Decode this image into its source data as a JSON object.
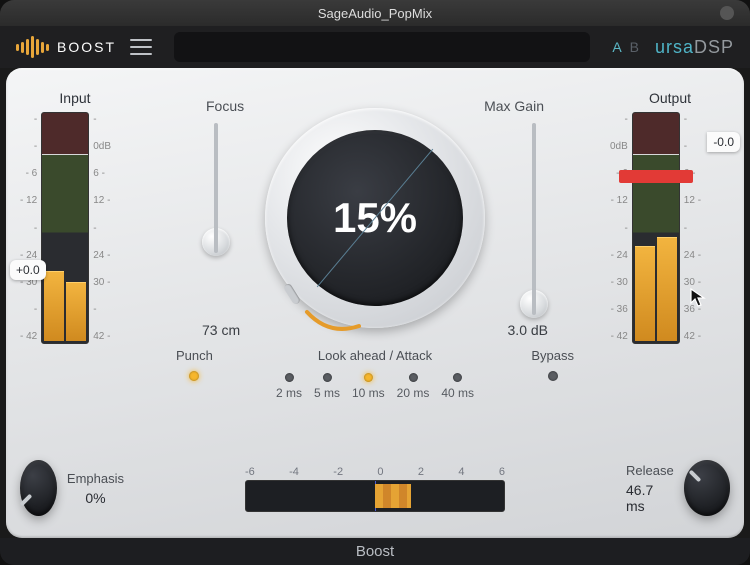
{
  "window": {
    "title": "SageAudio_PopMix"
  },
  "header": {
    "product_name": "BOOST",
    "ab": {
      "a": "A",
      "b": "B"
    },
    "brand_ursa": "ursa",
    "brand_dsp": "DSP"
  },
  "input": {
    "label": "Input",
    "ticks_left": [
      "-",
      "-",
      "- 6",
      "- 12",
      "-",
      "- 24",
      "- 30",
      "-",
      "- 42"
    ],
    "ticks_right": [
      "-",
      "0dB",
      "6 -",
      "12 -",
      "-",
      "24 -",
      "30 -",
      "-",
      "42 -"
    ],
    "badge": "+0.0",
    "level_pct_l": 31,
    "level_pct_r": 26
  },
  "output": {
    "label": "Output",
    "ticks_left": [
      "-",
      "0dB",
      "- 6",
      "- 12",
      "-",
      "- 24",
      "- 30",
      "- 36",
      "- 42"
    ],
    "ticks_right": [
      "-",
      "-",
      "6 -",
      "12 -",
      "-",
      "24 -",
      "30 -",
      "36 -",
      "42 -"
    ],
    "badge": "-0.0",
    "level_pct_l": 42,
    "level_pct_r": 46,
    "clip": true
  },
  "center": {
    "percent_label": "15%",
    "focus_label": "Focus",
    "max_gain_label": "Max Gain",
    "focus_value": "73 cm",
    "max_gain_value": "3.0 dB"
  },
  "punch": {
    "label": "Punch",
    "on": true
  },
  "bypass": {
    "label": "Bypass",
    "on": false
  },
  "lookahead": {
    "title": "Look ahead / Attack",
    "options": [
      {
        "label": "2 ms",
        "on": false
      },
      {
        "label": "5 ms",
        "on": false
      },
      {
        "label": "10 ms",
        "on": true
      },
      {
        "label": "20 ms",
        "on": false
      },
      {
        "label": "40 ms",
        "on": false
      }
    ]
  },
  "emphasis": {
    "label": "Emphasis",
    "value": "0%"
  },
  "release": {
    "label": "Release",
    "value": "46.7 ms"
  },
  "balance": {
    "ticks": [
      "-6",
      "-4",
      "-2",
      "0",
      "2",
      "4",
      "6"
    ],
    "left_pct": 50,
    "width_pct": 14
  },
  "footer": {
    "label": "Boost"
  }
}
